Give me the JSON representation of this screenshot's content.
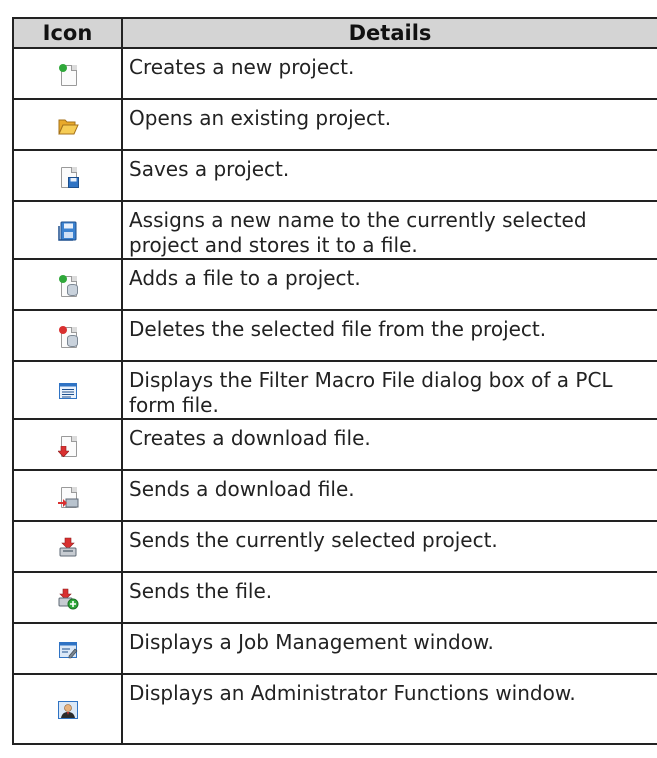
{
  "table": {
    "headers": {
      "icon": "Icon",
      "details": "Details"
    },
    "rows": [
      {
        "icon": "new-project-icon",
        "details": "Creates a new project."
      },
      {
        "icon": "open-project-icon",
        "details": "Opens an existing project."
      },
      {
        "icon": "save-project-icon",
        "details": "Saves a project."
      },
      {
        "icon": "save-as-icon",
        "details": "Assigns a new name to the currently selected project and stores it to a file."
      },
      {
        "icon": "add-file-icon",
        "details": "Adds a file to a project."
      },
      {
        "icon": "delete-file-icon",
        "details": "Deletes the selected file from the project."
      },
      {
        "icon": "filter-macro-icon",
        "details": "Displays the Filter Macro File dialog box of a PCL form file."
      },
      {
        "icon": "create-download-file-icon",
        "details": "Creates a download file."
      },
      {
        "icon": "send-download-file-icon",
        "details": "Sends a download file."
      },
      {
        "icon": "send-project-icon",
        "details": "Sends the currently selected project."
      },
      {
        "icon": "send-file-icon",
        "details": "Sends the file."
      },
      {
        "icon": "job-management-icon",
        "details": "Displays a Job Management window."
      },
      {
        "icon": "administrator-functions-icon",
        "details": "Displays an Administrator Functions window."
      }
    ]
  }
}
